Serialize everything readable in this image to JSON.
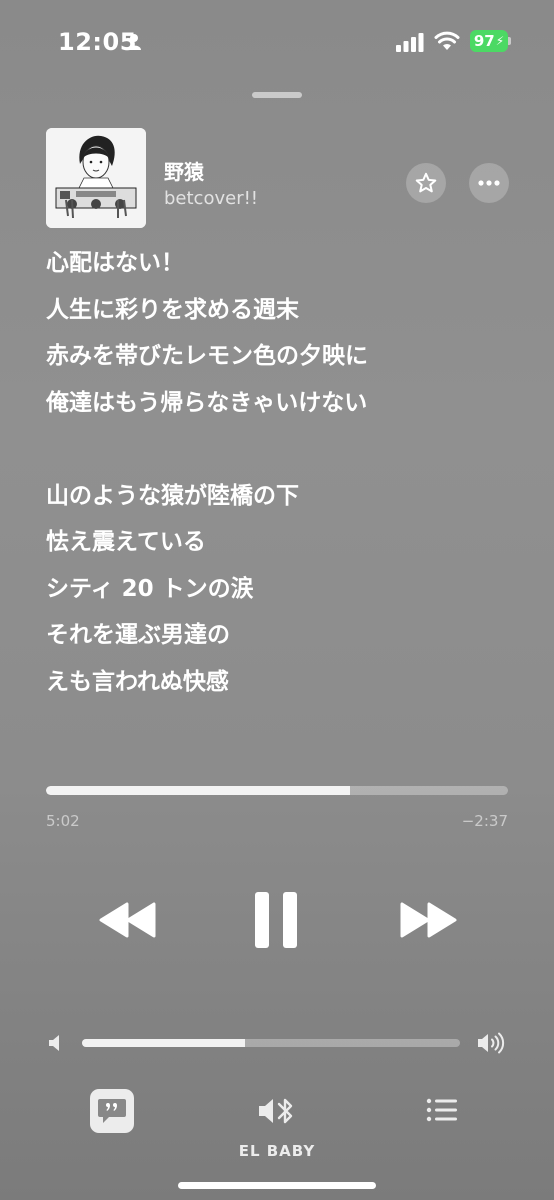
{
  "status_bar": {
    "time": "12:05",
    "battery": "97"
  },
  "now_playing": {
    "title": "野猿",
    "artist": "betcover!!",
    "artwork_icon": "album-artwork",
    "star_icon": "star-icon",
    "more_icon": "ellipsis-icon"
  },
  "lyrics": {
    "stanza_1": [
      "心配はない！",
      "人生に彩りを求める週末",
      "赤みを帯びたレモン色の夕映に",
      "俺達はもう帰らなきゃいけない"
    ],
    "stanza_2": [
      "山のような猿が陸橋の下",
      "怯え震えている",
      "シティ 20 トンの涙",
      "それを運ぶ男達の",
      "えも言われぬ快感"
    ]
  },
  "playback": {
    "elapsed": "5:02",
    "remaining": "−2:37",
    "progress_fraction": 0.659
  },
  "volume": {
    "level_fraction": 0.43
  },
  "bottom_bar": {
    "airplay_label": "EL BABY"
  },
  "colors": {
    "battery": "#4cd964",
    "background": "#8c8c8c"
  }
}
